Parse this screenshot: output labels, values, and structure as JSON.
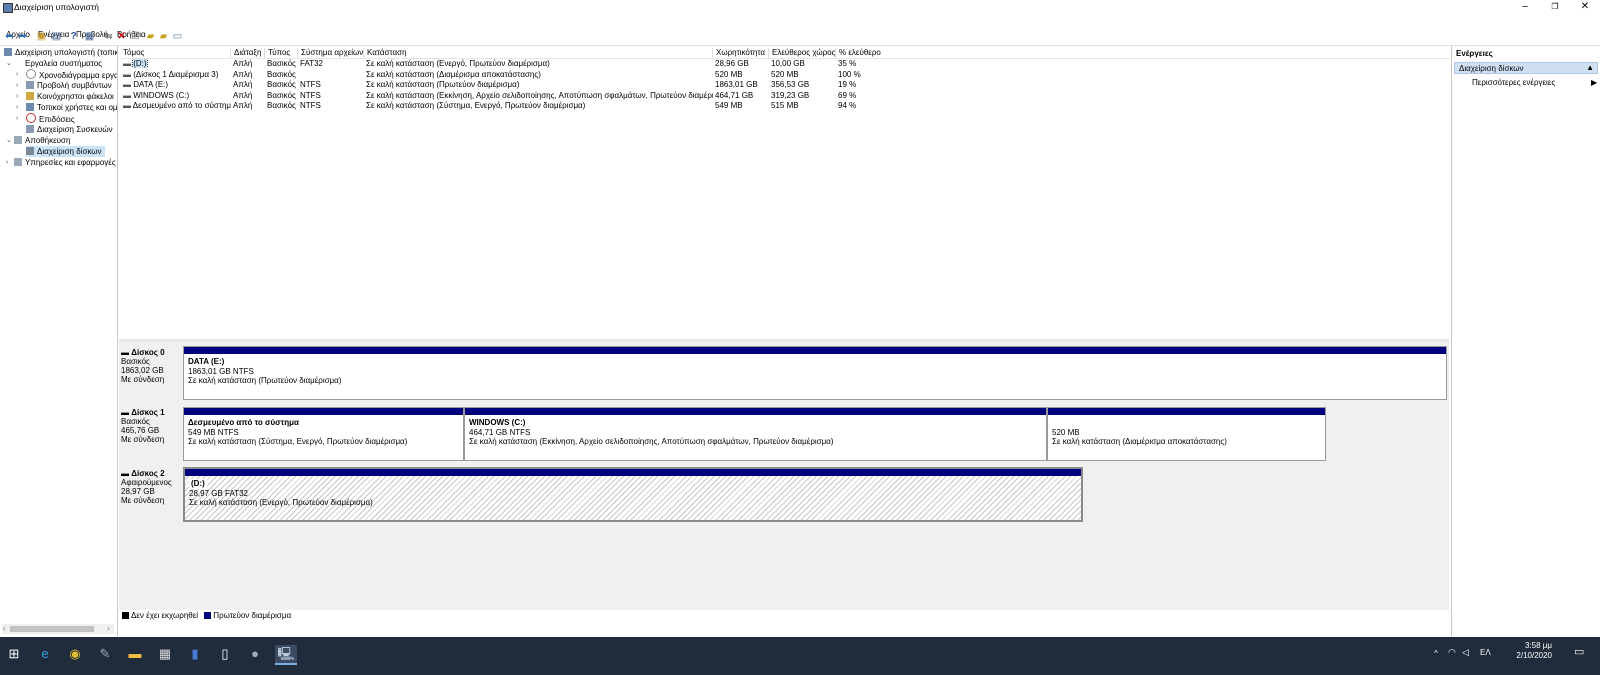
{
  "window": {
    "title": "Διαχείριση υπολογιστή",
    "minimize": "–",
    "restore": "❐",
    "close": "✕"
  },
  "menu": [
    "Αρχείο",
    "Ενέργεια",
    "Προβολή",
    "Βοήθεια"
  ],
  "tree": {
    "items": [
      {
        "label": "Διαχείριση υπολογιστή (τοπικ",
        "icon": "computer-icon"
      },
      {
        "label": "Εργαλεία συστήματος",
        "icon": "tools-icon"
      },
      {
        "label": "Χρονοδιάγραμμα εργασ",
        "icon": "clock-icon"
      },
      {
        "label": "Προβολή συμβάντων",
        "icon": "event-viewer-icon"
      },
      {
        "label": "Κοινόχρηστοι φάκελοι",
        "icon": "shared-folder-icon"
      },
      {
        "label": "Τοπικοί χρήστες και ομ",
        "icon": "users-icon"
      },
      {
        "label": "Επιδόσεις",
        "icon": "performance-icon"
      },
      {
        "label": "Διαχείριση Συσκευών",
        "icon": "device-manager-icon"
      },
      {
        "label": "Αποθήκευση",
        "icon": "storage-icon"
      },
      {
        "label": "Διαχείριση δίσκων",
        "icon": "disk-management-icon"
      },
      {
        "label": "Υπηρεσίες και εφαρμογές",
        "icon": "services-icon"
      }
    ]
  },
  "volumes": {
    "headers": [
      "Τόμος",
      "Διάταξη",
      "Τύπος",
      "Σύστημα αρχείων",
      "Κατάσταση",
      "Χωρητικότητα",
      "Ελεύθερος χώρος",
      "% ελεύθερο"
    ],
    "rows": [
      [
        "(D:)",
        "Απλή",
        "Βασικός",
        "FAT32",
        "Σε καλή κατάσταση (Ενεργό, Πρωτεύον διαμέρισμα)",
        "28,96 GB",
        "10,00 GB",
        "35 %"
      ],
      [
        "(Δίσκος 1 Διαμέρισμα 3)",
        "Απλή",
        "Βασικός",
        "",
        "Σε καλή κατάσταση (Διαμέρισμα αποκατάστασης)",
        "520 MB",
        "520 MB",
        "100 %"
      ],
      [
        "DATA (E:)",
        "Απλή",
        "Βασικός",
        "NTFS",
        "Σε καλή κατάσταση (Πρωτεύον διαμέρισμα)",
        "1863,01 GB",
        "356,53 GB",
        "19 %"
      ],
      [
        "WINDOWS (C:)",
        "Απλή",
        "Βασικός",
        "NTFS",
        "Σε καλή κατάσταση (Εκκίνηση, Αρχείο σελιδοποίησης, Αποτύπωση σφαλμάτων, Πρωτεύον διαμέρισμα)",
        "464,71 GB",
        "319,23 GB",
        "69 %"
      ],
      [
        "Δεσμευμένο από το σύστημα",
        "Απλή",
        "Βασικός",
        "NTFS",
        "Σε καλή κατάσταση (Σύστημα, Ενεργό, Πρωτεύον διαμέρισμα)",
        "549 MB",
        "515 MB",
        "94 %"
      ]
    ]
  },
  "disks": [
    {
      "name": "Δίσκος 0",
      "type": "Βασικός",
      "size": "1863,02 GB",
      "status": "Με σύνδεση",
      "partitions": [
        {
          "name": "DATA  (E:)",
          "size": "1863,01 GB NTFS",
          "status": "Σε καλή κατάσταση (Πρωτεύον διαμέρισμα)"
        }
      ]
    },
    {
      "name": "Δίσκος 1",
      "type": "Βασικός",
      "size": "465,76 GB",
      "status": "Με σύνδεση",
      "partitions": [
        {
          "name": "Δεσμευμένο από το σύστημα",
          "size": "549 MB NTFS",
          "status": "Σε καλή κατάσταση (Σύστημα, Ενεργό, Πρωτεύον διαμέρισμα)"
        },
        {
          "name": "WINDOWS  (C:)",
          "size": "464,71 GB NTFS",
          "status": "Σε καλή κατάσταση (Εκκίνηση, Αρχείο σελιδοποίησης, Αποτύπωση σφαλμάτων, Πρωτεύον διαμέρισμα)"
        },
        {
          "name": "",
          "size": "520 MB",
          "status": "Σε καλή κατάσταση (Διαμέρισμα αποκατάστασης)"
        }
      ]
    },
    {
      "name": "Δίσκος 2",
      "type": "Αφαιρούμενος",
      "size": "28,97 GB",
      "status": "Με σύνδεση",
      "partitions": [
        {
          "name": "(D:)",
          "size": "28,97 GB FAT32",
          "status": "Σε καλή κατάσταση (Ενεργό, Πρωτεύον διαμέρισμα)"
        }
      ]
    }
  ],
  "legend": {
    "unallocated": "Δεν έχει εκχωρηθεί",
    "primary": "Πρωτεύον διαμέρισμα",
    "unallocated_color": "#000000",
    "primary_color": "#00007f"
  },
  "actions": {
    "title": "Ενέργειες",
    "section": "Διαχείριση δίσκων",
    "more": "Περισσότερες ενέργειες"
  },
  "taskbar": {
    "time": "3:58 μμ",
    "date": "2/10/2020",
    "lang": "ΕΛ"
  }
}
